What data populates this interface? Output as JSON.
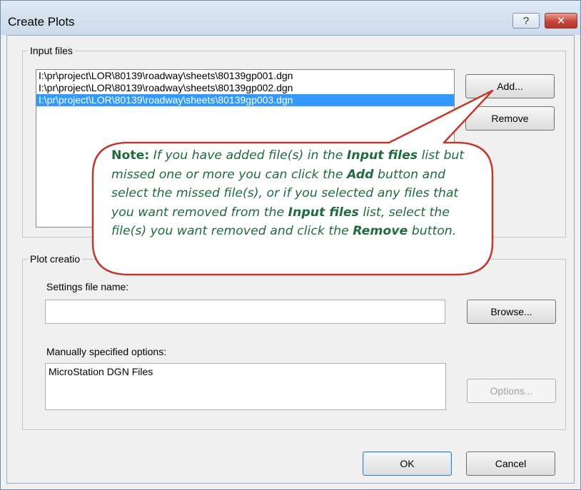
{
  "window": {
    "title": "Create Plots",
    "help_label": "?",
    "close_label": "✕"
  },
  "input_files": {
    "group_label": "Input files",
    "files": [
      "I:\\pr\\project\\LOR\\80139\\roadway\\sheets\\80139gp001.dgn",
      "I:\\pr\\project\\LOR\\80139\\roadway\\sheets\\80139gp002.dgn",
      "I:\\pr\\project\\LOR\\80139\\roadway\\sheets\\80139gp003.dgn"
    ],
    "selected_index": 2,
    "add_label": "Add...",
    "remove_label": "Remove"
  },
  "plot_creation": {
    "group_label": "Plot creatio",
    "settings_label": "Settings file name:",
    "settings_value": "",
    "browse_label": "Browse...",
    "manual_label": "Manually specified options:",
    "manual_value": "MicroStation DGN Files",
    "options_label": "Options..."
  },
  "footer": {
    "ok_label": "OK",
    "cancel_label": "Cancel"
  },
  "callout": {
    "note_label": "Note:",
    "t1": "If you have added file(s) in the",
    "e1": "Input files",
    "t2": "list but missed one or more you can click the",
    "e2": "Add",
    "t3": "button and select the missed file(s), or if you selected any files that you want removed from the",
    "e3": "Input files",
    "t4": "list, select the file(s) you want removed and click the",
    "e4": "Remove",
    "t5": "button.",
    "fill_color": "#ffffff",
    "border_color": "#c0392b",
    "text_color": "#1f6b3f"
  }
}
